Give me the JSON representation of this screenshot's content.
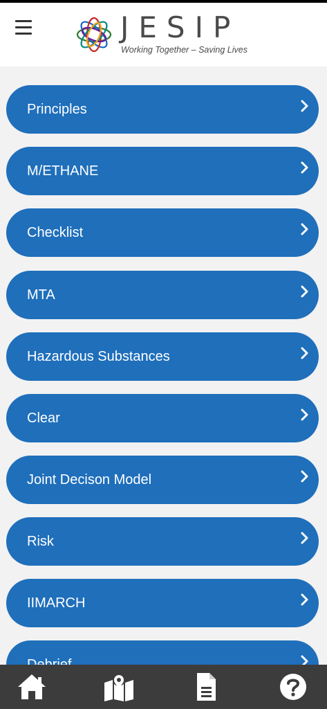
{
  "header": {
    "menu_icon": "hamburger-menu-icon",
    "logo_text": "JESIP",
    "tagline": "Working Together – Saving Lives"
  },
  "menu_items": [
    {
      "label": "Principles"
    },
    {
      "label": "M/ETHANE"
    },
    {
      "label": "Checklist"
    },
    {
      "label": "MTA"
    },
    {
      "label": "Hazardous Substances"
    },
    {
      "label": "Clear"
    },
    {
      "label": "Joint Decison Model"
    },
    {
      "label": "Risk"
    },
    {
      "label": "IIMARCH"
    },
    {
      "label": "Debrief"
    }
  ],
  "bottom_nav": [
    {
      "icon": "home-icon"
    },
    {
      "icon": "map-icon"
    },
    {
      "icon": "document-icon"
    },
    {
      "icon": "help-icon"
    }
  ],
  "colors": {
    "button_blue": "#1f6fbb",
    "nav_bar": "#3c3c3c",
    "background": "#f2f2f2"
  }
}
